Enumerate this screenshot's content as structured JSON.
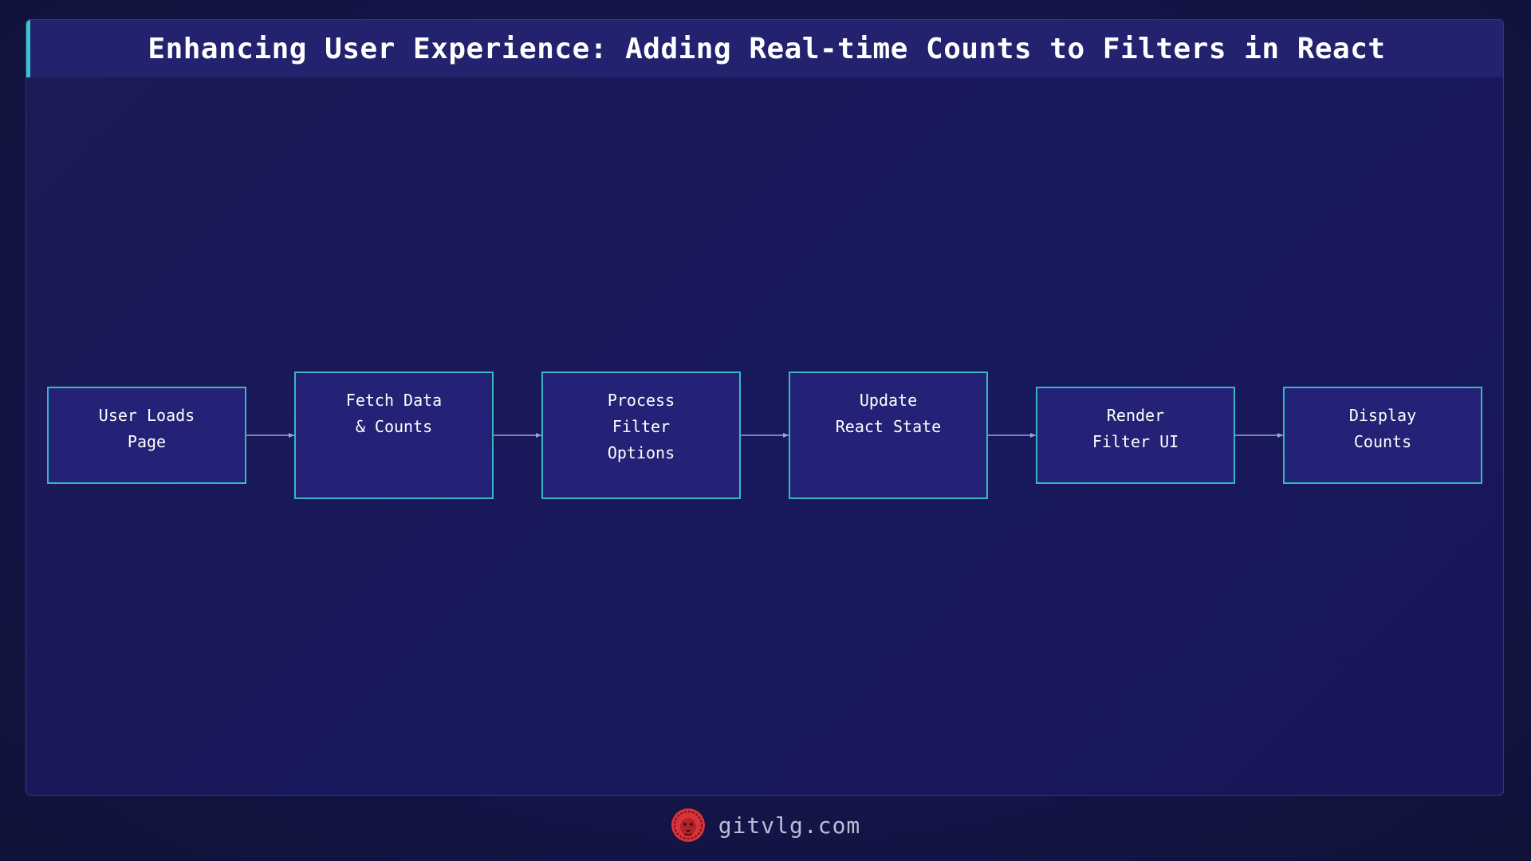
{
  "title": "Enhancing User Experience: Adding Real-time Counts to Filters in React",
  "flow": {
    "steps": [
      {
        "label": "User Loads\nPage"
      },
      {
        "label": "Fetch Data\n& Counts"
      },
      {
        "label": "Process\nFilter\nOptions"
      },
      {
        "label": "Update\nReact State"
      },
      {
        "label": "Render\nFilter UI"
      },
      {
        "label": "Display\nCounts"
      }
    ]
  },
  "footer": {
    "site": "gitvlg.com",
    "logo_icon": "lion-head-icon"
  },
  "colors": {
    "background": "#121442",
    "title_bar": "#22226e",
    "accent": "#38c6cc",
    "node_fill": "#232276",
    "node_border": "#38b6c8",
    "arrow": "#9aa6cf",
    "logo": "#d8333c"
  }
}
